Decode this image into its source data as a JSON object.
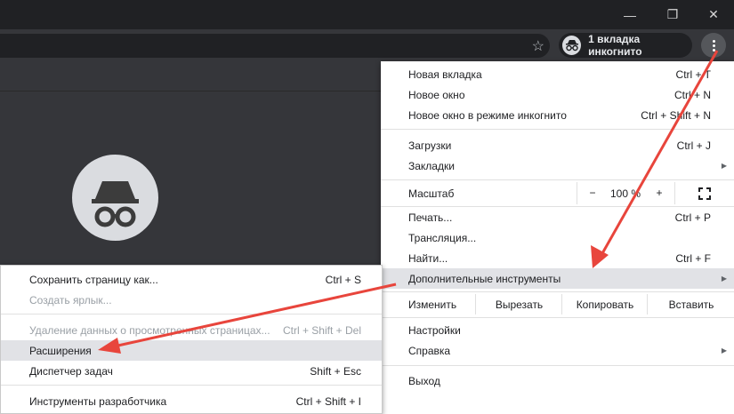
{
  "window": {
    "minimize": "—",
    "restore": "❐",
    "close": "✕"
  },
  "toolbar": {
    "incognito_label": "1 вкладка инкогнито"
  },
  "menu": {
    "group1": [
      {
        "label": "Новая вкладка",
        "shortcut": "Ctrl + T"
      },
      {
        "label": "Новое окно",
        "shortcut": "Ctrl + N"
      },
      {
        "label": "Новое окно в режиме инкогнито",
        "shortcut": "Ctrl + Shift + N"
      }
    ],
    "downloads": {
      "label": "Загрузки",
      "shortcut": "Ctrl + J"
    },
    "bookmarks": {
      "label": "Закладки"
    },
    "zoom": {
      "label": "Масштаб",
      "minus": "−",
      "value": "100 %",
      "plus": "+"
    },
    "print": {
      "label": "Печать...",
      "shortcut": "Ctrl + P"
    },
    "cast": {
      "label": "Трансляция..."
    },
    "find": {
      "label": "Найти...",
      "shortcut": "Ctrl + F"
    },
    "more_tools": {
      "label": "Дополнительные инструменты"
    },
    "edit": {
      "label": "Изменить",
      "cut": "Вырезать",
      "copy": "Копировать",
      "paste": "Вставить"
    },
    "settings": {
      "label": "Настройки"
    },
    "help": {
      "label": "Справка"
    },
    "exit": {
      "label": "Выход"
    }
  },
  "submenu": {
    "save_page": {
      "label": "Сохранить страницу как...",
      "shortcut": "Ctrl + S"
    },
    "create_shortcut": {
      "label": "Создать ярлык..."
    },
    "clear_data": {
      "label": "Удаление данных о просмотренных страницах...",
      "shortcut": "Ctrl + Shift + Del"
    },
    "extensions": {
      "label": "Расширения"
    },
    "task_manager": {
      "label": "Диспетчер задач",
      "shortcut": "Shift + Esc"
    },
    "dev_tools": {
      "label": "Инструменты разработчика",
      "shortcut": "Ctrl + Shift + I"
    }
  },
  "colors": {
    "arrow": "#e8453c",
    "highlight": "#e1e2e6"
  }
}
